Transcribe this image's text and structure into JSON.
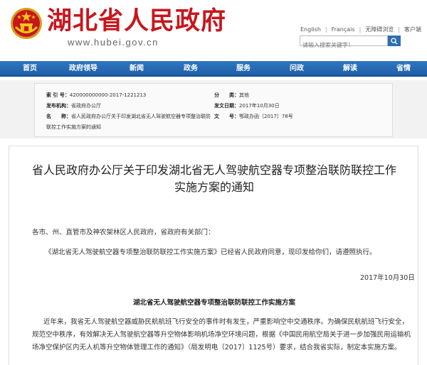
{
  "header": {
    "site_title": "湖北省人民政府",
    "site_url": "www.hubei.gov.cn",
    "links": [
      "English",
      "Français",
      "无障碍浏览",
      "客户端"
    ],
    "search_placeholder": "请输入搜索关键字！",
    "search_icon": "search-icon",
    "emblem_icon": "national-emblem-icon"
  },
  "nav": {
    "items": [
      "首页",
      "政府领导",
      "新闻",
      "政务",
      "服务",
      "问政",
      "解读",
      "省情"
    ]
  },
  "meta": {
    "index_label": "索 引 号：",
    "index_value": "420000000000-2017-1221213",
    "category_label": "分　　类：",
    "category_value": "其他",
    "issuer_label": "发布机构：",
    "issuer_value": "省政府办公厅",
    "date_label": "发文日期：",
    "date_value": "2017年10月30日",
    "name_label": "名　　称：",
    "name_value_line1": "省人民政府办公厅关于印发湖北省无人驾驶航空器专项整治联防",
    "name_value_line2": "联控工作实施方案的通知",
    "docno_label": "文　　号：",
    "docno_value": "鄂政办函〔2017〕78号"
  },
  "article": {
    "title_line1": "省人民政府办公厅关于印发湖北省无人驾驶航空器专项整治联防联控工作",
    "title_line2": "实施方案的通知",
    "recipients": "各市、州、直管市及神农架林区人民政府，省政府有关部门：",
    "body": "《湖北省无人驾驶航空器专项整治联防联控工作实施方案》已经省人民政府同意，现印发给你们，请遵照执行。",
    "sign_date": "2017年10月30日",
    "sub_title": "湖北省无人驾驶航空器专项整治联防联控工作实施方案",
    "para1_line1": "近年来，我省无人驾驶航空器威胁民航航班飞行安全的事件时有发生，严重影响空中交通秩序。为确保民航航班飞行安全，",
    "para1_line2": "规范空中秩序，有效解决无人驾驶航空器等升空物体影响机场净空环境问题，根据《中国民用航空局关于进一步加强民用运输机",
    "para1_line3": "场净空保护区内无人机等升空物体管理工作的通知》（局发明电〔2017〕1125号）要求，结合我省实际，制定本实施方案。"
  },
  "colors": {
    "brand_red": "#c8161d",
    "nav_blue": "#1f5fa8"
  }
}
